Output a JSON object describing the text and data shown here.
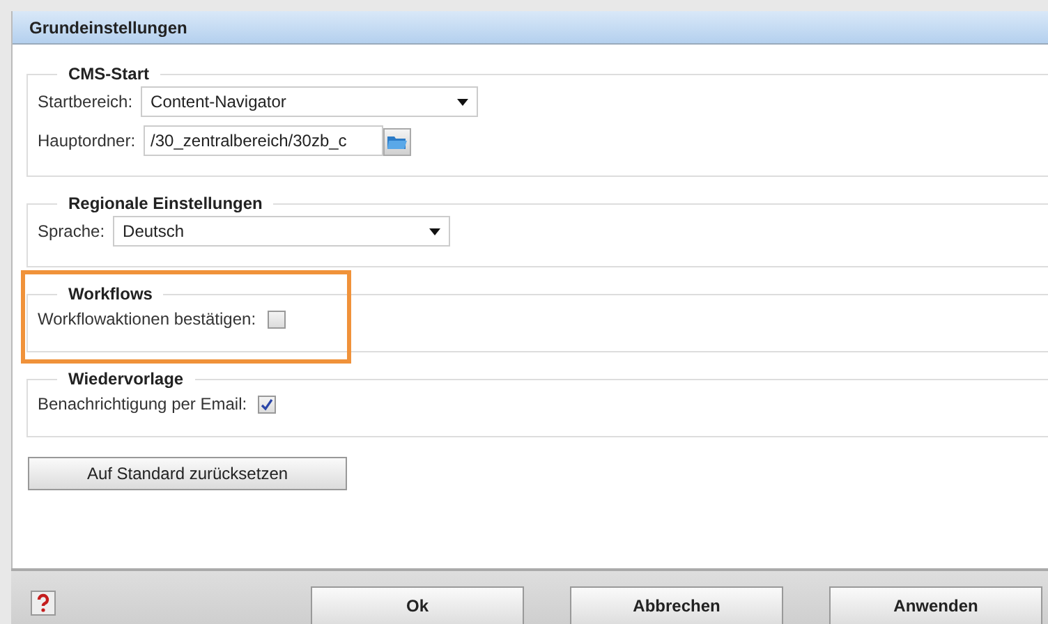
{
  "window": {
    "title": "Grundeinstellungen"
  },
  "sections": [
    {
      "title": "CMS-Start",
      "highlighted": false,
      "fields": [
        {
          "kind": "select",
          "label": "Startbereich:",
          "value": "Content-Navigator"
        },
        {
          "kind": "path",
          "label": "Hauptordner:",
          "value": "/30_zentralbereich/30zb_c"
        }
      ]
    },
    {
      "title": "Regionale Einstellungen",
      "highlighted": false,
      "fields": [
        {
          "kind": "select",
          "label": "Sprache:",
          "value": "Deutsch"
        }
      ]
    },
    {
      "title": "Workflows",
      "highlighted": true,
      "fields": [
        {
          "kind": "checkbox",
          "label": "Workflowaktionen bestätigen:",
          "checked": false
        }
      ]
    },
    {
      "title": "Wiedervorlage",
      "highlighted": false,
      "fields": [
        {
          "kind": "checkbox",
          "label": "Benachrichtigung per Email:",
          "checked": true
        }
      ]
    }
  ],
  "reset_button": "Auf Standard zurücksetzen",
  "footer_buttons": [
    "Ok",
    "Abbrechen",
    "Anwenden"
  ]
}
